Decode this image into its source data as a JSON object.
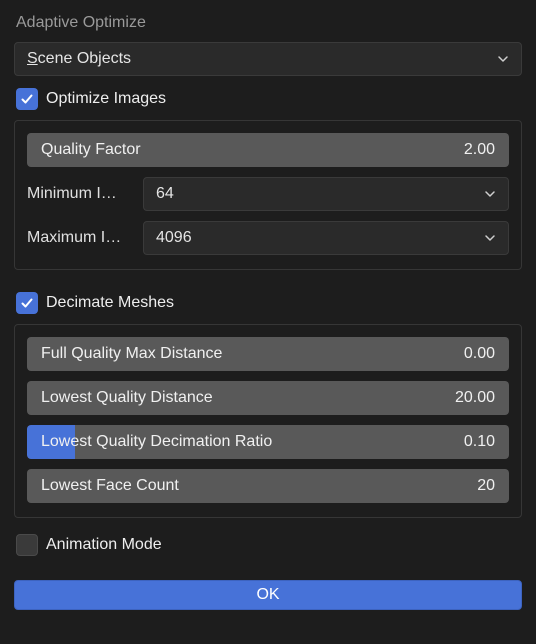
{
  "panel": {
    "title": "Adaptive Optimize",
    "main_dropdown": {
      "prefix": "S",
      "rest": "cene Objects"
    }
  },
  "optimize_images": {
    "checkbox_label": "Optimize Images",
    "checked": true,
    "quality_factor": {
      "label": "Quality Factor",
      "value": "2.00",
      "fill_pct": 0
    },
    "min_image": {
      "label": "Minimum I…",
      "value": "64"
    },
    "max_image": {
      "label": "Maximum I…",
      "value": "4096"
    }
  },
  "decimate_meshes": {
    "checkbox_label": "Decimate Meshes",
    "checked": true,
    "full_quality_max_distance": {
      "label": "Full Quality Max Distance",
      "value": "0.00",
      "fill_pct": 0
    },
    "lowest_quality_distance": {
      "label": "Lowest Quality Distance",
      "value": "20.00",
      "fill_pct": 0
    },
    "lowest_quality_decimation_ratio": {
      "label": "Lowest Quality Decimation Ratio",
      "value": "0.10",
      "fill_pct": 10
    },
    "lowest_face_count": {
      "label": "Lowest Face Count",
      "value": "20",
      "fill_pct": 0
    }
  },
  "animation_mode": {
    "label": "Animation Mode",
    "checked": false
  },
  "ok_button": "OK"
}
